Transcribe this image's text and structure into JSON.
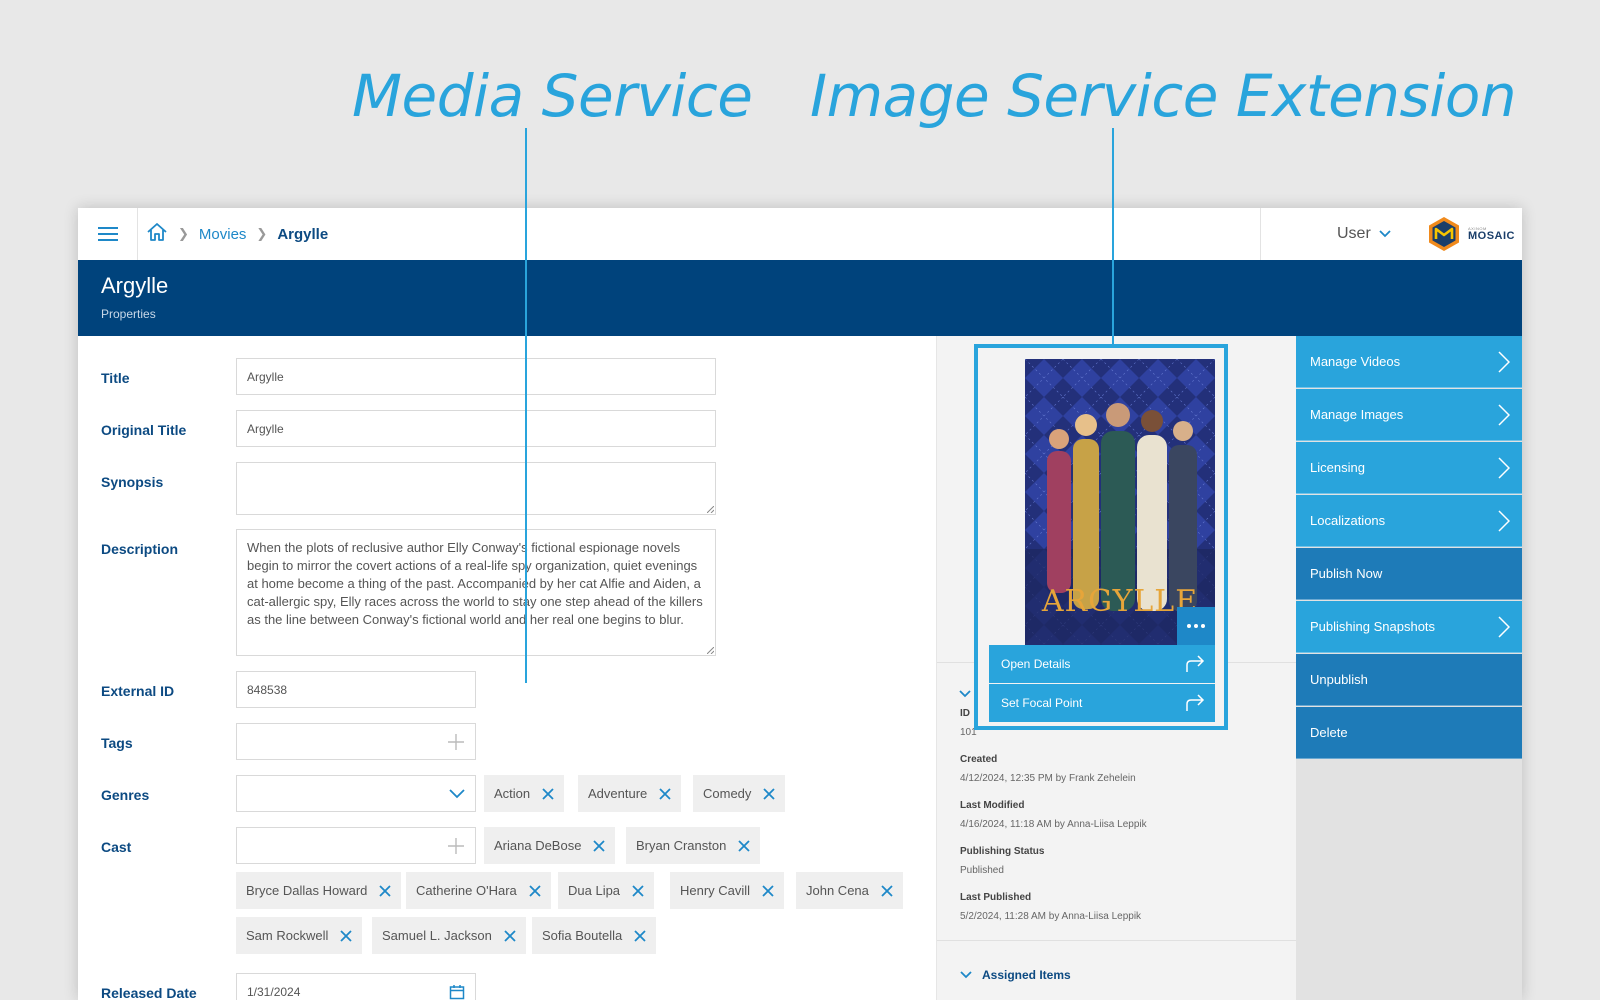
{
  "callouts": {
    "media_service": "Media Service",
    "image_service_extension": "Image Service Extension"
  },
  "breadcrumb": {
    "items": [
      "Movies"
    ],
    "current": "Argylle"
  },
  "user": {
    "label": "User"
  },
  "logo": {
    "small": "AXINOM",
    "main": "MOSAIC"
  },
  "header": {
    "title": "Argylle",
    "subtitle": "Properties"
  },
  "form": {
    "title": {
      "label": "Title",
      "value": "Argylle"
    },
    "original_title": {
      "label": "Original Title",
      "value": "Argylle"
    },
    "synopsis": {
      "label": "Synopsis",
      "value": ""
    },
    "description": {
      "label": "Description",
      "value": "When the plots of reclusive author Elly Conway's fictional espionage novels begin to mirror the covert actions of a real-life spy organization, quiet evenings at home become a thing of the past. Accompanied by her cat Alfie and Aiden, a cat-allergic spy, Elly races across the world to stay one step ahead of the killers as the line between Conway's fictional world and her real one begins to blur."
    },
    "external_id": {
      "label": "External ID",
      "value": "848538"
    },
    "tags": {
      "label": "Tags",
      "value": ""
    },
    "genres": {
      "label": "Genres",
      "selected": [
        "Action",
        "Adventure",
        "Comedy"
      ]
    },
    "cast": {
      "label": "Cast",
      "members": [
        "Ariana DeBose",
        "Bryan Cranston",
        "Bryce Dallas Howard",
        "Catherine O'Hara",
        "Dua Lipa",
        "Henry Cavill",
        "John Cena",
        "Sam Rockwell",
        "Samuel L. Jackson",
        "Sofia Boutella"
      ]
    },
    "released_date": {
      "label": "Released Date",
      "value": "1/31/2024"
    }
  },
  "image": {
    "poster_title": "ARGYLLE",
    "menu": [
      "Open Details",
      "Set Focal Point"
    ]
  },
  "details": {
    "id_label": "ID",
    "id_value": "101",
    "created_label": "Created",
    "created_value": "4/12/2024, 12:35 PM by Frank Zehelein",
    "modified_label": "Last Modified",
    "modified_value": "4/16/2024, 11:18 AM by Anna-Liisa Leppik",
    "status_label": "Publishing Status",
    "status_value": "Published",
    "published_label": "Last Published",
    "published_value": "5/2/2024, 11:28 AM by Anna-Liisa Leppik",
    "assigned_label": "Assigned Items"
  },
  "actions": [
    {
      "label": "Manage Videos"
    },
    {
      "label": "Manage Images"
    },
    {
      "label": "Licensing"
    },
    {
      "label": "Localizations"
    },
    {
      "label": "Publish Now"
    },
    {
      "label": "Publishing Snapshots"
    },
    {
      "label": "Unpublish"
    },
    {
      "label": "Delete"
    }
  ]
}
